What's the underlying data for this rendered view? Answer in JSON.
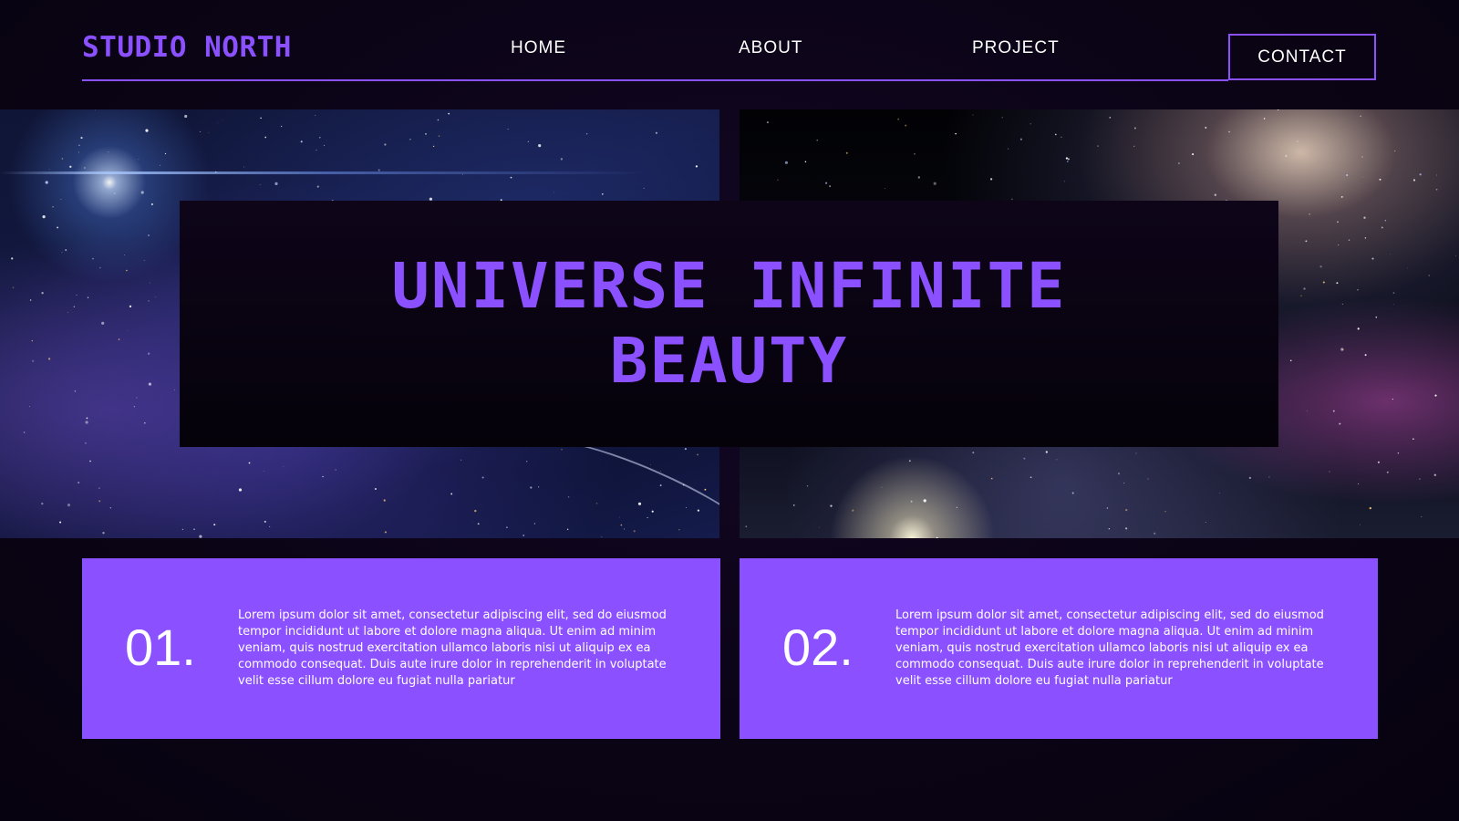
{
  "header": {
    "brand": "STUDIO NORTH",
    "nav": {
      "home": "HOME",
      "about": "ABOUT",
      "project": "PROJECT"
    },
    "contact_label": "CONTACT"
  },
  "hero": {
    "title_line1": "UNIVERSE INFINITE",
    "title_line2": "BEAUTY"
  },
  "cards": [
    {
      "number": "01.",
      "text": "Lorem ipsum dolor sit amet, consectetur adipiscing elit, sed do eiusmod tempor incididunt ut labore et dolore magna aliqua. Ut enim ad minim veniam, quis nostrud exercitation ullamco laboris nisi ut aliquip ex ea commodo consequat. Duis aute irure dolor in reprehenderit in voluptate velit esse cillum dolore eu fugiat nulla pariatur"
    },
    {
      "number": "02.",
      "text": "Lorem ipsum dolor sit amet, consectetur adipiscing elit, sed do eiusmod tempor incididunt ut labore et dolore magna aliqua. Ut enim ad minim veniam, quis nostrud exercitation ullamco laboris nisi ut aliquip ex ea commodo consequat. Duis aute irure dolor in reprehenderit in voluptate velit esse cillum dolore eu fugiat nulla pariatur"
    }
  ],
  "colors": {
    "accent": "#8b50ff",
    "background": "#0b0416",
    "text": "#ffffff"
  }
}
